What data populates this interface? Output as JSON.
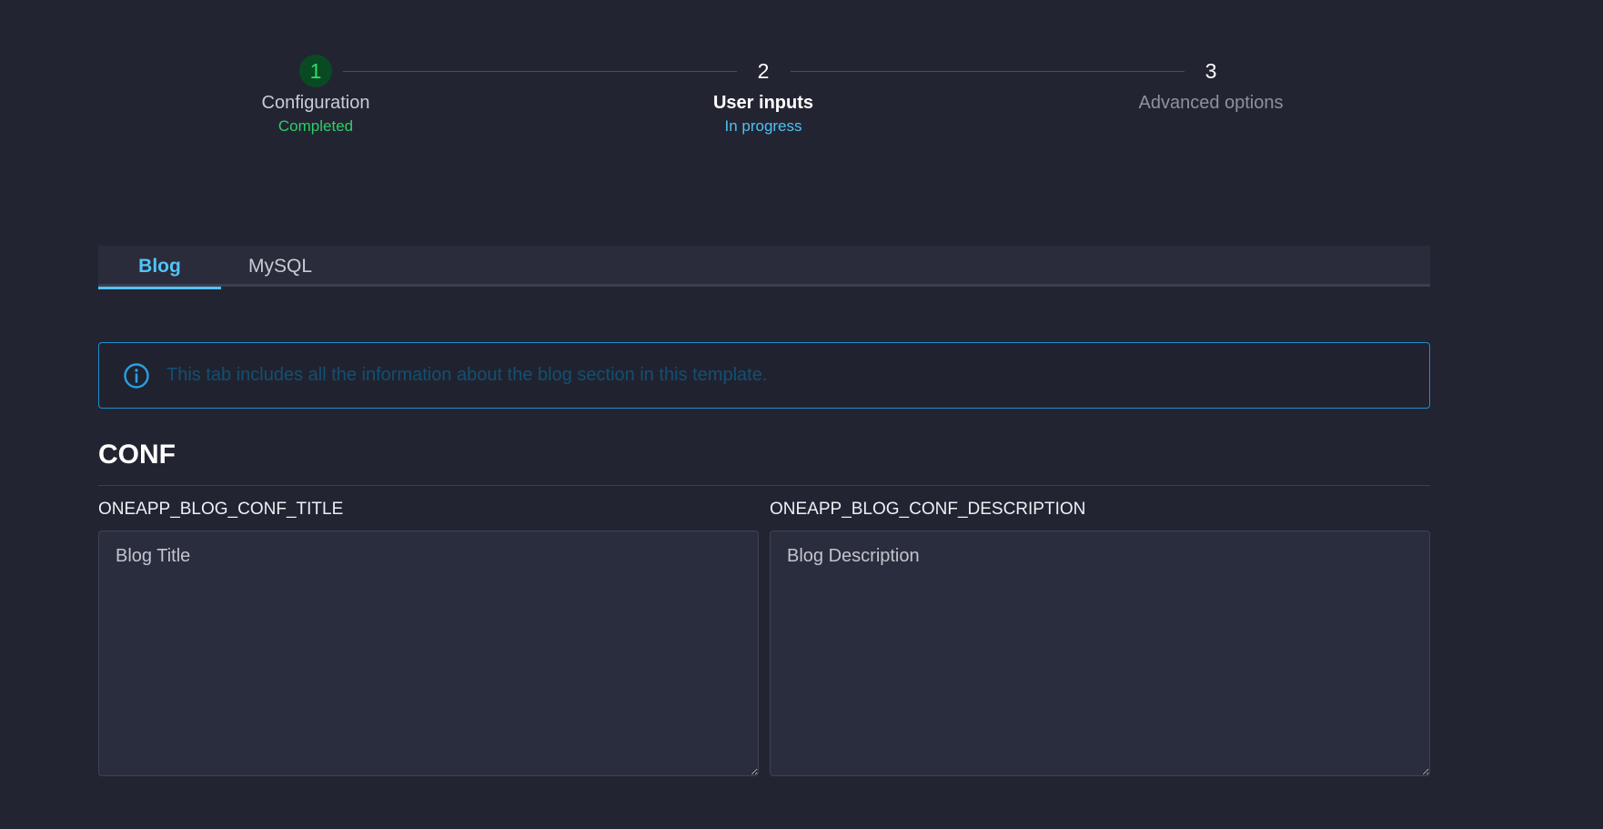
{
  "stepper": {
    "steps": [
      {
        "number": "1",
        "label": "Configuration",
        "status": "Completed"
      },
      {
        "number": "2",
        "label": "User inputs",
        "status": "In progress"
      },
      {
        "number": "3",
        "label": "Advanced options",
        "status": ""
      }
    ]
  },
  "tabs": [
    {
      "label": "Blog",
      "active": true
    },
    {
      "label": "MySQL",
      "active": false
    }
  ],
  "info": {
    "icon": "info-icon",
    "text": "This tab includes all the information about the blog section in this template."
  },
  "section": {
    "title": "CONF"
  },
  "fields": [
    {
      "label": "ONEAPP_BLOG_CONF_TITLE",
      "value": "",
      "placeholder": "Blog Title"
    },
    {
      "label": "ONEAPP_BLOG_CONF_DESCRIPTION",
      "value": "",
      "placeholder": "Blog Description"
    }
  ],
  "colors": {
    "background": "#222432",
    "accent": "#52c4f5",
    "completed": "#2ccf63",
    "info_border": "#1e8ed0"
  }
}
